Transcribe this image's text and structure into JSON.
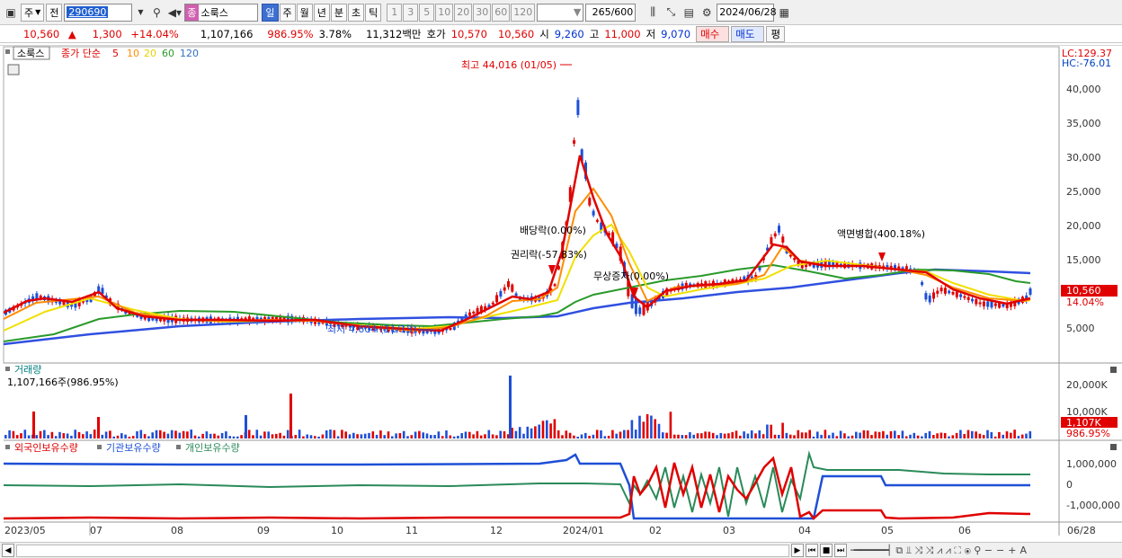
{
  "toolbar": {
    "market_label": "주",
    "prev_label": "전",
    "stock_code": "290690",
    "stock_type_badge": "종",
    "stock_name": "소룩스",
    "period_buttons": [
      "일",
      "주",
      "월",
      "년",
      "분",
      "초",
      "틱"
    ],
    "selected_period": "일",
    "interval_buttons": [
      "1",
      "3",
      "5",
      "10",
      "20",
      "30",
      "60",
      "120"
    ],
    "count_value": "265",
    "count_total": "/600",
    "date_value": "2024/06/28"
  },
  "quote": {
    "price": "10,560",
    "change_arrow": "▲",
    "change": "1,300",
    "change_rate": "+14.04%",
    "volume": "1,107,166",
    "volume_rate": "986.95%",
    "turnover": "3.78%",
    "amount": "11,312백만",
    "hoga_label": "호가",
    "ask": "10,570",
    "bid": "10,560",
    "open_label": "시",
    "open": "9,260",
    "high_label": "고",
    "high": "11,000",
    "low_label": "저",
    "low": "9,070",
    "buy_label": "매수",
    "sell_label": "매도",
    "eval_label": "평"
  },
  "price_panel": {
    "stock_tab": "소룩스",
    "ma_title": "종가 단순",
    "ma_periods": [
      "5",
      "10",
      "20",
      "60",
      "120"
    ],
    "lc": "LC:129.37",
    "hc": "HC:-76.01",
    "y_ticks": [
      "40,000",
      "35,000",
      "30,000",
      "25,000",
      "20,000",
      "15,000",
      "10,000",
      "5,000"
    ],
    "current_price_tag": "10,560",
    "current_rate_tag": "14.04%",
    "annotations": {
      "high": "최고 44,016 (01/05)",
      "low": "최저 4,604 (11/13)",
      "dividend": "배당락(0.00%)",
      "rights": "권리락(-57.83%)",
      "bonus": "무상증자(0.00%)",
      "split": "액면병합(400.18%)"
    }
  },
  "volume_panel": {
    "title": "거래량",
    "value": "1,107,166주(986.95%)",
    "y_ticks": [
      "20,000K",
      "10,000K"
    ],
    "current_tag": "1,107K",
    "rate_tag": "986.95%"
  },
  "holdings_panel": {
    "legend": [
      "외국인보유수량",
      "기관보유수량",
      "개인보유수량"
    ],
    "y_ticks": [
      "1,000,000",
      "0",
      "-1,000,000"
    ]
  },
  "x_axis": [
    "2023/05",
    "07",
    "08",
    "09",
    "10",
    "11",
    "12",
    "2024/01",
    "02",
    "03",
    "04",
    "05",
    "06",
    "06/28"
  ],
  "colors": {
    "ma5": "#e00000",
    "ma10": "#ff8c00",
    "ma20": "#f0e000",
    "ma60": "#2a9a2a",
    "ma120": "#3050e0",
    "up": "#e00000",
    "down": "#1e4fd6"
  }
}
